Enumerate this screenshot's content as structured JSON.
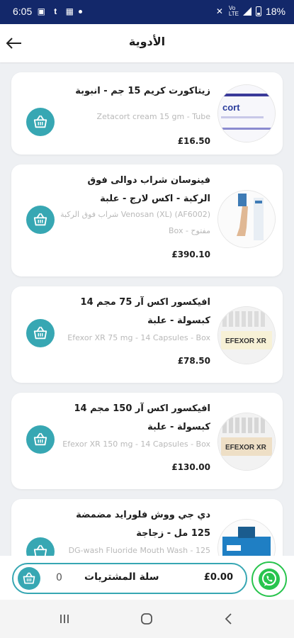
{
  "status_bar": {
    "time": "6:05",
    "battery_percent": "18%"
  },
  "header": {
    "title": "الأدوية"
  },
  "products": [
    {
      "name_ar": "زيتاكورت كريم 15 جم - انبوبة",
      "name_en": "Zetacort cream 15 gm - Tube",
      "price": "£16.50",
      "image_text": "cort"
    },
    {
      "name_ar": "فينوسان شراب دوالى فوق الركبة - اكس لارج - علبة",
      "name_en": "Venosan (XL) (AF6002) شراب فوق الركبة مفتوح - Box",
      "price": "£390.10",
      "image_text": ""
    },
    {
      "name_ar": "افيكسور اكس آر 75 مجم 14 كبسولة - علبة",
      "name_en": "Efexor XR 75 mg - 14 Capsules - Box",
      "price": "£78.50",
      "image_text": "EFEXOR XR"
    },
    {
      "name_ar": "افيكسور اكس آر 150 مجم 14 كبسولة - علبة",
      "name_en": "Efexor XR 150 mg - 14 Capsules - Box",
      "price": "£130.00",
      "image_text": "EFEXOR XR"
    },
    {
      "name_ar": "دي جي ووش فلورايد مضمضة 125 مل - زجاجة",
      "name_en": "DG-wash Fluoride Mouth Wash - 125",
      "price": "",
      "image_text": ""
    }
  ],
  "cart": {
    "count": "0",
    "label": "سلة المشتريات",
    "total": "£0.00"
  },
  "icons": {
    "back": "arrow-left-icon",
    "basket": "basket-icon",
    "whatsapp": "whatsapp-icon"
  },
  "colors": {
    "status_bar": "#13286a",
    "accent": "#37a7b3",
    "whatsapp": "#28c44d",
    "background": "#eef0f3"
  }
}
